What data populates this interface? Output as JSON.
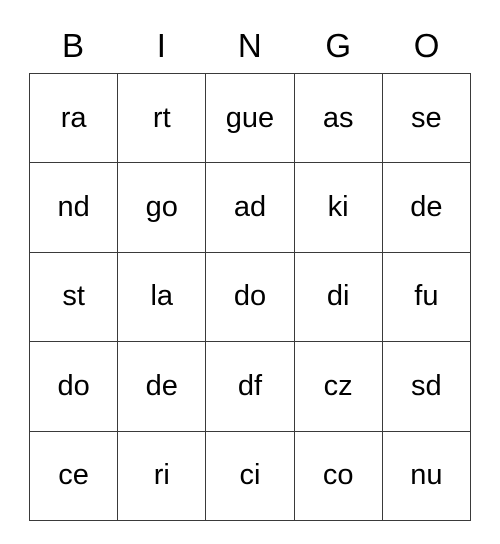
{
  "card": {
    "headers": [
      "B",
      "I",
      "N",
      "G",
      "O"
    ],
    "rows": [
      [
        "ra",
        "rt",
        "gue",
        "as",
        "se"
      ],
      [
        "nd",
        "go",
        "ad",
        "ki",
        "de"
      ],
      [
        "st",
        "la",
        "do",
        "di",
        "fu"
      ],
      [
        "do",
        "de",
        "df",
        "cz",
        "sd"
      ],
      [
        "ce",
        "ri",
        "ci",
        "co",
        "nu"
      ]
    ],
    "colors": {
      "text": "#000000",
      "border": "#3a3a3a",
      "background": "#ffffff"
    }
  }
}
